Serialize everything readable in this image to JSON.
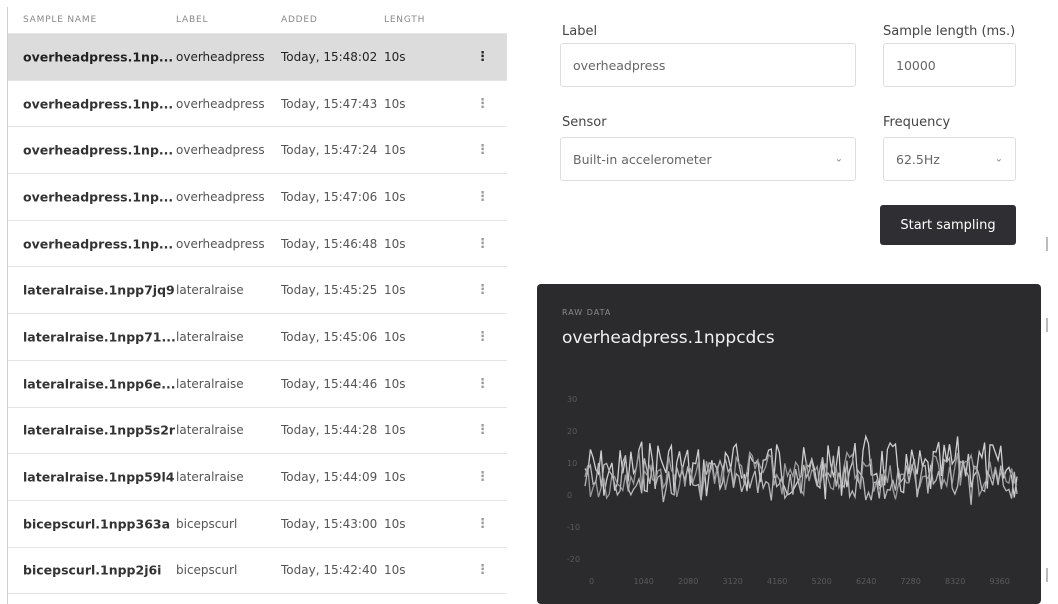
{
  "table": {
    "headers": {
      "name": "SAMPLE NAME",
      "label": "LABEL",
      "added": "ADDED",
      "length": "LENGTH"
    },
    "rows": [
      {
        "name": "overheadpress.1np...",
        "label": "overheadpress",
        "added": "Today, 15:48:02",
        "length": "10s",
        "selected": true
      },
      {
        "name": "overheadpress.1np...",
        "label": "overheadpress",
        "added": "Today, 15:47:43",
        "length": "10s"
      },
      {
        "name": "overheadpress.1np...",
        "label": "overheadpress",
        "added": "Today, 15:47:24",
        "length": "10s"
      },
      {
        "name": "overheadpress.1np...",
        "label": "overheadpress",
        "added": "Today, 15:47:06",
        "length": "10s"
      },
      {
        "name": "overheadpress.1np...",
        "label": "overheadpress",
        "added": "Today, 15:46:48",
        "length": "10s"
      },
      {
        "name": "lateralraise.1npp7jq9",
        "label": "lateralraise",
        "added": "Today, 15:45:25",
        "length": "10s"
      },
      {
        "name": "lateralraise.1npp71...",
        "label": "lateralraise",
        "added": "Today, 15:45:06",
        "length": "10s"
      },
      {
        "name": "lateralraise.1npp6e...",
        "label": "lateralraise",
        "added": "Today, 15:44:46",
        "length": "10s"
      },
      {
        "name": "lateralraise.1npp5s2r",
        "label": "lateralraise",
        "added": "Today, 15:44:28",
        "length": "10s"
      },
      {
        "name": "lateralraise.1npp59l4",
        "label": "lateralraise",
        "added": "Today, 15:44:09",
        "length": "10s"
      },
      {
        "name": "bicepscurl.1npp363a",
        "label": "bicepscurl",
        "added": "Today, 15:43:00",
        "length": "10s"
      },
      {
        "name": "bicepscurl.1npp2j6i",
        "label": "bicepscurl",
        "added": "Today, 15:42:40",
        "length": "10s"
      }
    ],
    "menu_icon": "vertical-dots-icon"
  },
  "form": {
    "label_title": "Label",
    "label_value": "overheadpress",
    "length_title": "Sample length (ms.)",
    "length_value": "10000",
    "sensor_title": "Sensor",
    "sensor_value": "Built-in accelerometer",
    "frequency_title": "Frequency",
    "frequency_value": "62.5Hz",
    "start_button": "Start sampling"
  },
  "raw_data": {
    "caption": "RAW DATA",
    "title": "overheadpress.1nppcdcs",
    "x_ticks": [
      "0",
      "1040",
      "2080",
      "3120",
      "4160",
      "5200",
      "6240",
      "7280",
      "8320",
      "9360"
    ],
    "y_ticks": [
      "30",
      "20",
      "10",
      "0",
      "-10",
      "-20"
    ]
  },
  "colors": {
    "selected_row": "#dcdcdc",
    "button_bg": "#2f2f33",
    "raw_panel_bg": "#2b2b2e"
  }
}
